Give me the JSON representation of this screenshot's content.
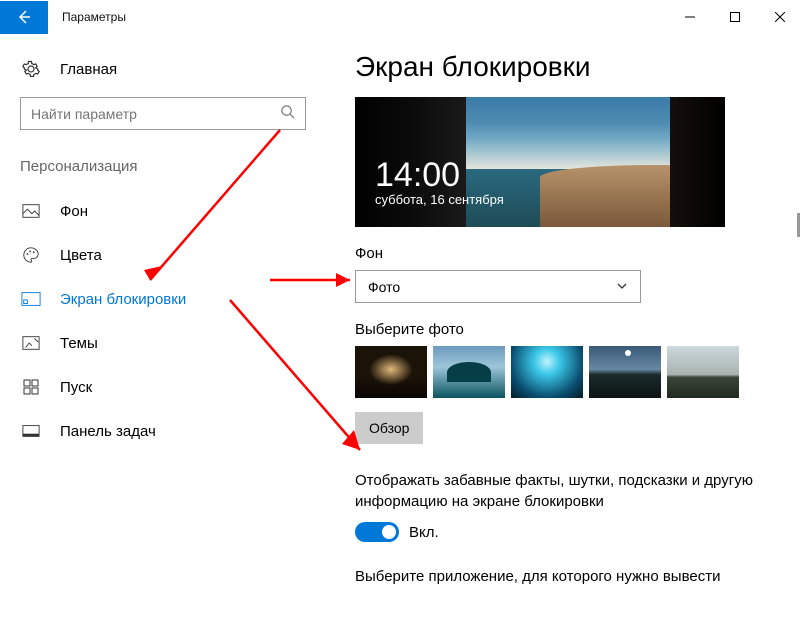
{
  "titlebar": {
    "title": "Параметры"
  },
  "sidebar": {
    "home": "Главная",
    "search_placeholder": "Найти параметр",
    "group": "Персонализация",
    "items": [
      {
        "label": "Фон"
      },
      {
        "label": "Цвета"
      },
      {
        "label": "Экран блокировки"
      },
      {
        "label": "Темы"
      },
      {
        "label": "Пуск"
      },
      {
        "label": "Панель задач"
      }
    ]
  },
  "main": {
    "title": "Экран блокировки",
    "preview": {
      "time": "14:00",
      "date": "суббота, 16 сентября"
    },
    "bg_label": "Фон",
    "bg_value": "Фото",
    "choose_label": "Выберите фото",
    "browse": "Обзор",
    "fun_text": "Отображать забавные факты, шутки, подсказки и другую информацию на экране блокировки",
    "toggle_label": "Вкл.",
    "bottom_text": "Выберите приложение, для которого нужно вывести"
  }
}
